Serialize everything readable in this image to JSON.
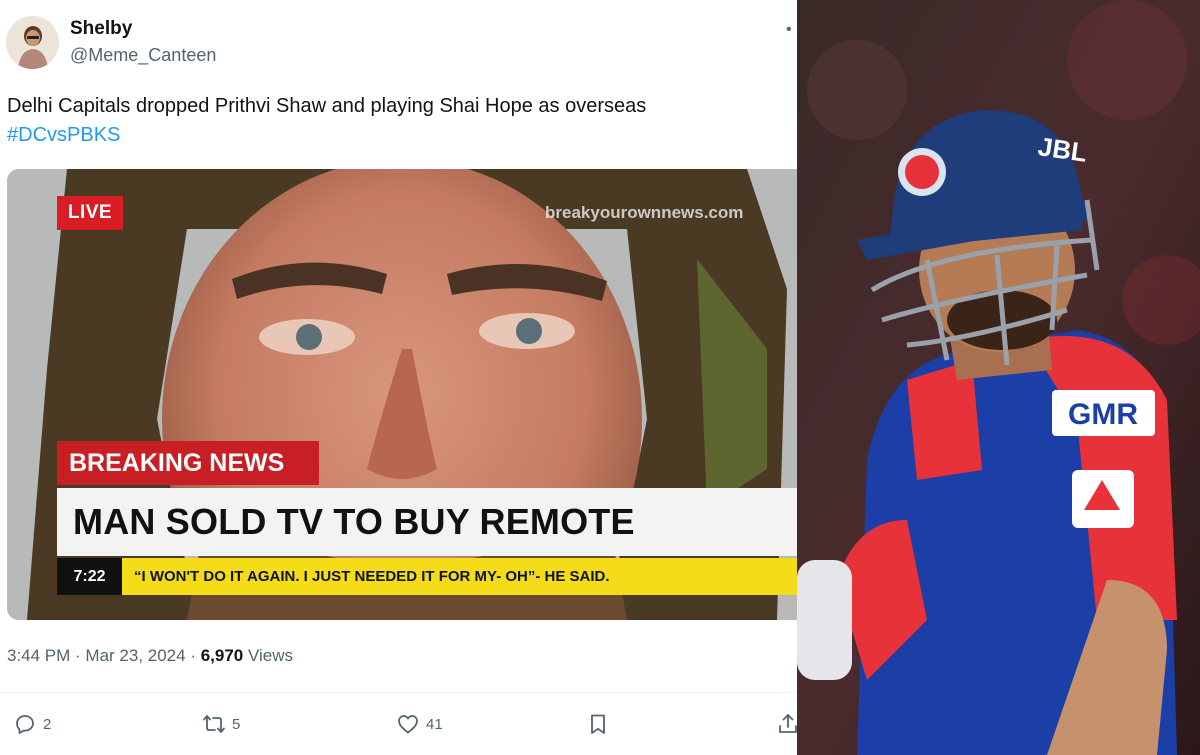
{
  "tweet": {
    "author": {
      "display_name": "Shelby",
      "handle": "@Meme_Canteen",
      "avatar_icon": "user-avatar"
    },
    "more_icon": "more-dot-icon",
    "text": "Delhi Capitals dropped Prithvi Shaw and playing Shai Hope as overseas",
    "hashtag": "#DCvsPBKS",
    "media": {
      "live_label": "LIVE",
      "watermark": "breakyourownnews.com",
      "breaking_label": "BREAKING NEWS",
      "headline": "MAN SOLD TV TO BUY REMOTE",
      "ticker_time": "7:22",
      "ticker_text": "“I WON'T DO IT AGAIN. I JUST NEEDED IT FOR MY- OH”- HE SAID."
    },
    "meta": {
      "time": "3:44 PM",
      "separator": " · ",
      "date": "Mar 23, 2024",
      "views_count": "6,970",
      "views_label": " Views"
    },
    "actions": {
      "replies": "2",
      "reposts": "5",
      "likes": "41"
    }
  },
  "photo": {
    "helmet_text": "JBL",
    "jersey_sponsor": "GMR",
    "colors": {
      "helmet": "#1f3d7a",
      "jersey_blue": "#1b3fa6",
      "jersey_red": "#e8323a"
    }
  },
  "colors": {
    "accent": "#1d9bf0",
    "muted": "#536471",
    "live_red": "#d81e24",
    "ticker_yellow": "#f4dc18"
  }
}
